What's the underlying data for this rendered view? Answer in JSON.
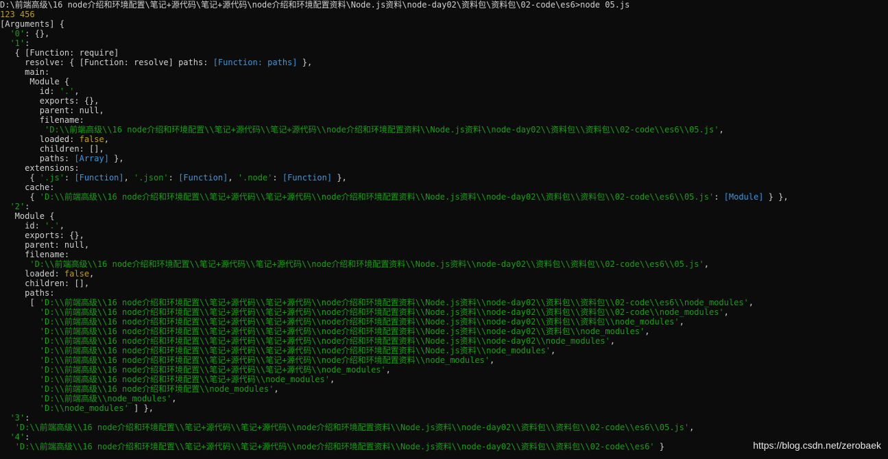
{
  "console": {
    "lines": [
      [
        [
          "w",
          "D:\\前端高级\\16 node介绍和环境配置\\笔记+源代码\\笔记+源代码\\node介绍和环境配置资料\\Node.js资料\\node-day02\\资料包\\资料包\\02-code\\es6>node 05.js"
        ]
      ],
      [
        [
          "y",
          "123 456"
        ]
      ],
      [
        [
          "w",
          "[Arguments] {"
        ]
      ],
      [
        [
          "w",
          "  "
        ],
        [
          "g",
          "'0'"
        ],
        [
          "w",
          ": {},"
        ]
      ],
      [
        [
          "w",
          "  "
        ],
        [
          "g",
          "'1'"
        ],
        [
          "w",
          ":"
        ]
      ],
      [
        [
          "w",
          "   { [Function: require]"
        ]
      ],
      [
        [
          "w",
          "     resolve: { [Function: resolve] paths: "
        ],
        [
          "c",
          "[Function: paths]"
        ],
        [
          "w",
          " },"
        ]
      ],
      [
        [
          "w",
          "     main:"
        ]
      ],
      [
        [
          "w",
          "      Module {"
        ]
      ],
      [
        [
          "w",
          "        id: "
        ],
        [
          "g",
          "'.'"
        ],
        [
          "w",
          ","
        ]
      ],
      [
        [
          "w",
          "        exports: {},"
        ]
      ],
      [
        [
          "w",
          "        parent: null,"
        ]
      ],
      [
        [
          "w",
          "        filename:"
        ]
      ],
      [
        [
          "w",
          "         "
        ],
        [
          "g",
          "'D:\\\\前端高级\\\\16 node介绍和环境配置\\\\笔记+源代码\\\\笔记+源代码\\\\node介绍和环境配置资料\\\\Node.js资料\\\\node-day02\\\\资料包\\\\资料包\\\\02-code\\\\es6\\\\05.js'"
        ],
        [
          "w",
          ","
        ]
      ],
      [
        [
          "w",
          "        loaded: "
        ],
        [
          "y",
          "false"
        ],
        [
          "w",
          ","
        ]
      ],
      [
        [
          "w",
          "        children: [],"
        ]
      ],
      [
        [
          "w",
          "        paths: "
        ],
        [
          "c",
          "[Array]"
        ],
        [
          "w",
          " },"
        ]
      ],
      [
        [
          "w",
          "     extensions:"
        ]
      ],
      [
        [
          "w",
          "      { "
        ],
        [
          "g",
          "'.js'"
        ],
        [
          "w",
          ": "
        ],
        [
          "c",
          "[Function]"
        ],
        [
          "w",
          ", "
        ],
        [
          "g",
          "'.json'"
        ],
        [
          "w",
          ": "
        ],
        [
          "c",
          "[Function]"
        ],
        [
          "w",
          ", "
        ],
        [
          "g",
          "'.node'"
        ],
        [
          "w",
          ": "
        ],
        [
          "c",
          "[Function]"
        ],
        [
          "w",
          " },"
        ]
      ],
      [
        [
          "w",
          "     cache:"
        ]
      ],
      [
        [
          "w",
          "      { "
        ],
        [
          "g",
          "'D:\\\\前端高级\\\\16 node介绍和环境配置\\\\笔记+源代码\\\\笔记+源代码\\\\node介绍和环境配置资料\\\\Node.js资料\\\\node-day02\\\\资料包\\\\资料包\\\\02-code\\\\es6\\\\05.js'"
        ],
        [
          "w",
          ": "
        ],
        [
          "c",
          "[Module]"
        ],
        [
          "w",
          " } },"
        ]
      ],
      [
        [
          "w",
          "  "
        ],
        [
          "g",
          "'2'"
        ],
        [
          "w",
          ":"
        ]
      ],
      [
        [
          "w",
          "   Module {"
        ]
      ],
      [
        [
          "w",
          "     id: "
        ],
        [
          "g",
          "'.'"
        ],
        [
          "w",
          ","
        ]
      ],
      [
        [
          "w",
          "     exports: {},"
        ]
      ],
      [
        [
          "w",
          "     parent: null,"
        ]
      ],
      [
        [
          "w",
          "     filename:"
        ]
      ],
      [
        [
          "w",
          "      "
        ],
        [
          "g",
          "'D:\\\\前端高级\\\\16 node介绍和环境配置\\\\笔记+源代码\\\\笔记+源代码\\\\node介绍和环境配置资料\\\\Node.js资料\\\\node-day02\\\\资料包\\\\资料包\\\\02-code\\\\es6\\\\05.js'"
        ],
        [
          "w",
          ","
        ]
      ],
      [
        [
          "w",
          "     loaded: "
        ],
        [
          "y",
          "false"
        ],
        [
          "w",
          ","
        ]
      ],
      [
        [
          "w",
          "     children: [],"
        ]
      ],
      [
        [
          "w",
          "     paths:"
        ]
      ],
      [
        [
          "w",
          "      [ "
        ],
        [
          "g",
          "'D:\\\\前端高级\\\\16 node介绍和环境配置\\\\笔记+源代码\\\\笔记+源代码\\\\node介绍和环境配置资料\\\\Node.js资料\\\\node-day02\\\\资料包\\\\资料包\\\\02-code\\\\es6\\\\node_modules'"
        ],
        [
          "w",
          ","
        ]
      ],
      [
        [
          "w",
          "        "
        ],
        [
          "g",
          "'D:\\\\前端高级\\\\16 node介绍和环境配置\\\\笔记+源代码\\\\笔记+源代码\\\\node介绍和环境配置资料\\\\Node.js资料\\\\node-day02\\\\资料包\\\\资料包\\\\02-code\\\\node_modules'"
        ],
        [
          "w",
          ","
        ]
      ],
      [
        [
          "w",
          "        "
        ],
        [
          "g",
          "'D:\\\\前端高级\\\\16 node介绍和环境配置\\\\笔记+源代码\\\\笔记+源代码\\\\node介绍和环境配置资料\\\\Node.js资料\\\\node-day02\\\\资料包\\\\资料包\\\\node_modules'"
        ],
        [
          "w",
          ","
        ]
      ],
      [
        [
          "w",
          "        "
        ],
        [
          "g",
          "'D:\\\\前端高级\\\\16 node介绍和环境配置\\\\笔记+源代码\\\\笔记+源代码\\\\node介绍和环境配置资料\\\\Node.js资料\\\\node-day02\\\\资料包\\\\node_modules'"
        ],
        [
          "w",
          ","
        ]
      ],
      [
        [
          "w",
          "        "
        ],
        [
          "g",
          "'D:\\\\前端高级\\\\16 node介绍和环境配置\\\\笔记+源代码\\\\笔记+源代码\\\\node介绍和环境配置资料\\\\Node.js资料\\\\node-day02\\\\node_modules'"
        ],
        [
          "w",
          ","
        ]
      ],
      [
        [
          "w",
          "        "
        ],
        [
          "g",
          "'D:\\\\前端高级\\\\16 node介绍和环境配置\\\\笔记+源代码\\\\笔记+源代码\\\\node介绍和环境配置资料\\\\Node.js资料\\\\node_modules'"
        ],
        [
          "w",
          ","
        ]
      ],
      [
        [
          "w",
          "        "
        ],
        [
          "g",
          "'D:\\\\前端高级\\\\16 node介绍和环境配置\\\\笔记+源代码\\\\笔记+源代码\\\\node介绍和环境配置资料\\\\node_modules'"
        ],
        [
          "w",
          ","
        ]
      ],
      [
        [
          "w",
          "        "
        ],
        [
          "g",
          "'D:\\\\前端高级\\\\16 node介绍和环境配置\\\\笔记+源代码\\\\笔记+源代码\\\\node_modules'"
        ],
        [
          "w",
          ","
        ]
      ],
      [
        [
          "w",
          "        "
        ],
        [
          "g",
          "'D:\\\\前端高级\\\\16 node介绍和环境配置\\\\笔记+源代码\\\\node_modules'"
        ],
        [
          "w",
          ","
        ]
      ],
      [
        [
          "w",
          "        "
        ],
        [
          "g",
          "'D:\\\\前端高级\\\\16 node介绍和环境配置\\\\node_modules'"
        ],
        [
          "w",
          ","
        ]
      ],
      [
        [
          "w",
          "        "
        ],
        [
          "g",
          "'D:\\\\前端高级\\\\node_modules'"
        ],
        [
          "w",
          ","
        ]
      ],
      [
        [
          "w",
          "        "
        ],
        [
          "g",
          "'D:\\\\node_modules'"
        ],
        [
          "w",
          " ] },"
        ]
      ],
      [
        [
          "w",
          "  "
        ],
        [
          "g",
          "'3'"
        ],
        [
          "w",
          ":"
        ]
      ],
      [
        [
          "w",
          "   "
        ],
        [
          "g",
          "'D:\\\\前端高级\\\\16 node介绍和环境配置\\\\笔记+源代码\\\\笔记+源代码\\\\node介绍和环境配置资料\\\\Node.js资料\\\\node-day02\\\\资料包\\\\资料包\\\\02-code\\\\es6\\\\05.js'"
        ],
        [
          "w",
          ","
        ]
      ],
      [
        [
          "w",
          "  "
        ],
        [
          "g",
          "'4'"
        ],
        [
          "w",
          ":"
        ]
      ],
      [
        [
          "w",
          "   "
        ],
        [
          "g",
          "'D:\\\\前端高级\\\\16 node介绍和环境配置\\\\笔记+源代码\\\\笔记+源代码\\\\node介绍和环境配置资料\\\\Node.js资料\\\\node-day02\\\\资料包\\\\资料包\\\\02-code\\\\es6'"
        ],
        [
          "w",
          " }"
        ]
      ]
    ]
  },
  "watermark": "https://blog.csdn.net/zerobaek",
  "colors": {
    "background": "#0c0c0c",
    "text": "#d0d0d0",
    "string": "#13a10e",
    "number_boolean": "#c0a000",
    "special": "#3a96dd"
  }
}
